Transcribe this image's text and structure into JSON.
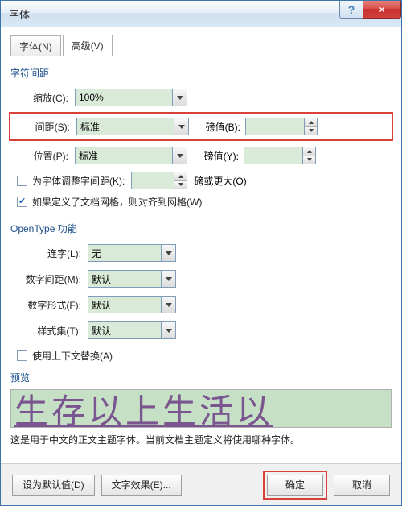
{
  "window": {
    "title": "字体"
  },
  "tabs": {
    "font": "字体(N)",
    "advanced": "高级(V)"
  },
  "charSpacing": {
    "sectionTitle": "字符间距",
    "scale": {
      "label": "缩放(C):",
      "value": "100%"
    },
    "spacing": {
      "label": "间距(S):",
      "value": "标准",
      "byLabel": "磅值(B):",
      "byValue": ""
    },
    "position": {
      "label": "位置(P):",
      "value": "标准",
      "byLabel": "磅值(Y):",
      "byValue": ""
    },
    "kerning": {
      "label": "为字体调整字间距(K):",
      "value": "",
      "unit": "磅或更大(O)",
      "checked": false
    },
    "snapGrid": {
      "label": "如果定义了文档网格，则对齐到网格(W)",
      "checked": true
    }
  },
  "opentype": {
    "sectionTitle": "OpenType 功能",
    "ligatures": {
      "label": "连字(L):",
      "value": "无"
    },
    "numSpacing": {
      "label": "数字间距(M):",
      "value": "默认"
    },
    "numForms": {
      "label": "数字形式(F):",
      "value": "默认"
    },
    "stylistic": {
      "label": "样式集(T):",
      "value": "默认"
    },
    "contextual": {
      "label": "使用上下文替换(A)",
      "checked": false
    }
  },
  "preview": {
    "title": "预览",
    "sample": "生存以上生活以",
    "desc": "这是用于中文的正文主题字体。当前文档主题定义将使用哪种字体。"
  },
  "footer": {
    "setDefault": "设为默认值(D)",
    "textEffects": "文字效果(E)...",
    "ok": "确定",
    "cancel": "取消"
  }
}
